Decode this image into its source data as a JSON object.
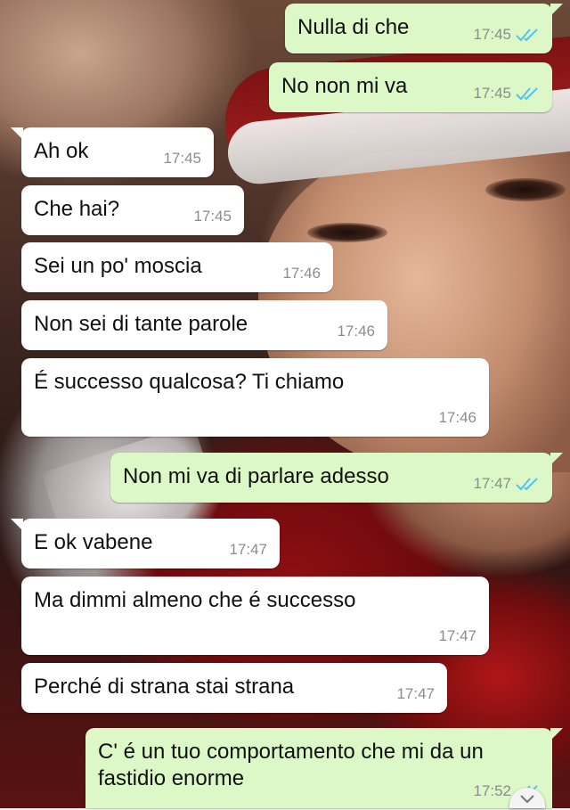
{
  "messages": [
    {
      "dir": "out",
      "text": "Nulla di che",
      "time": "17:45",
      "read": true
    },
    {
      "dir": "out",
      "text": "No non mi va",
      "time": "17:45",
      "read": true
    },
    {
      "dir": "in",
      "text": "Ah ok",
      "time": "17:45"
    },
    {
      "dir": "in",
      "text": "Che hai?",
      "time": "17:45"
    },
    {
      "dir": "in",
      "text": "Sei un po' moscia",
      "time": "17:46"
    },
    {
      "dir": "in",
      "text": "Non sei di tante parole",
      "time": "17:46"
    },
    {
      "dir": "in",
      "text": "É successo qualcosa? Ti chiamo",
      "time": "17:46"
    },
    {
      "dir": "out",
      "text": "Non mi va di parlare adesso",
      "time": "17:47",
      "read": true
    },
    {
      "dir": "in",
      "text": "E ok vabene",
      "time": "17:47"
    },
    {
      "dir": "in",
      "text": "Ma dimmi almeno che é successo",
      "time": "17:47"
    },
    {
      "dir": "in",
      "text": "Perché di strana stai strana",
      "time": "17:47"
    },
    {
      "dir": "out",
      "text": "C' é un tuo comportamento che mi da un fastidio enorme",
      "time": "17:52",
      "read": true
    }
  ],
  "colors": {
    "incoming": "#ffffff",
    "outgoing": "#dcf8c6",
    "read_ticks": "#4fc3f7",
    "time": "#8c8c8c"
  },
  "icons": {
    "read_receipt": "double-check-icon",
    "scroll": "chevron-down-icon"
  }
}
